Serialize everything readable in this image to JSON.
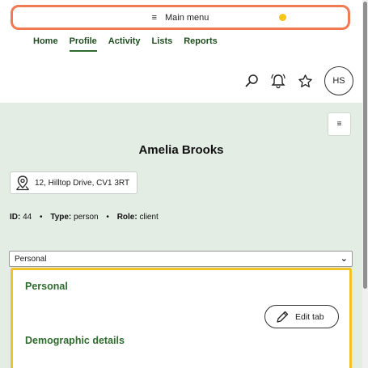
{
  "menu": {
    "label": "Main menu",
    "icon": "hamburger-icon"
  },
  "nav": {
    "items": [
      {
        "label": "Home"
      },
      {
        "label": "Profile"
      },
      {
        "label": "Activity"
      },
      {
        "label": "Lists"
      },
      {
        "label": "Reports"
      }
    ],
    "active": "Profile"
  },
  "header": {
    "avatar_initials": "HS"
  },
  "profile": {
    "name": "Amelia Brooks",
    "address": "12, Hilltop Drive, CV1 3RT",
    "id_label": "ID:",
    "id_value": "44",
    "type_label": "Type:",
    "type_value": "person",
    "role_label": "Role:",
    "role_value": "client"
  },
  "tab_select": {
    "selected": "Personal"
  },
  "panel": {
    "title": "Personal",
    "edit_label": "Edit tab",
    "section2": "Demographic details"
  },
  "colors": {
    "accent": "#2e6b2e",
    "highlight": "#f2c229",
    "menu_border": "#f07a52",
    "content_bg": "#e3ede3"
  }
}
